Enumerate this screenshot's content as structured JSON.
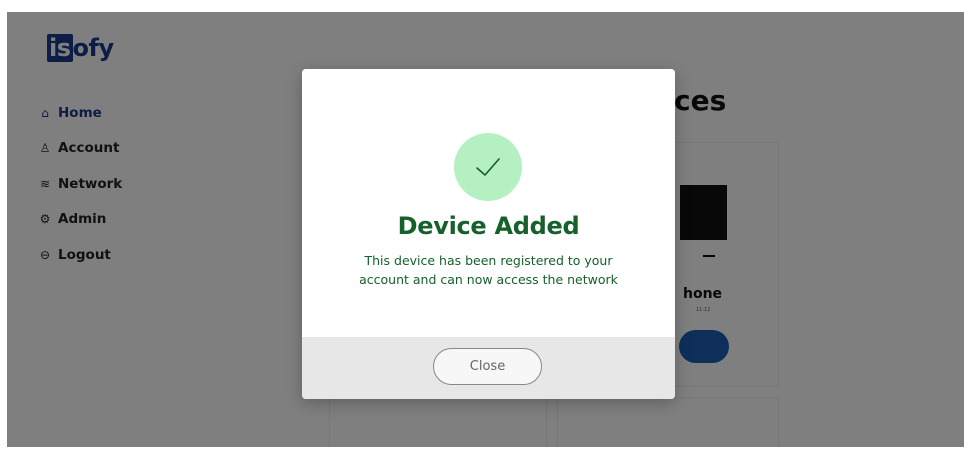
{
  "app": {
    "logo_is": "is",
    "logo_rest": "ofy"
  },
  "sidebar": {
    "items": [
      {
        "label": "Home",
        "icon": "home-icon",
        "glyph": "⌂",
        "active": true
      },
      {
        "label": "Account",
        "icon": "user-icon",
        "glyph": "♙",
        "active": false
      },
      {
        "label": "Network",
        "icon": "wifi-icon",
        "glyph": "≋",
        "active": false
      },
      {
        "label": "Admin",
        "icon": "gear-icon",
        "glyph": "⚙",
        "active": false
      },
      {
        "label": "Logout",
        "icon": "logout-icon",
        "glyph": "⊖",
        "active": false
      }
    ]
  },
  "main": {
    "title_visible_fragment": "ces",
    "device": {
      "name_visible_fragment": "hone",
      "meta_visible_fragment": "11:12"
    }
  },
  "modal": {
    "icon": "check-icon",
    "title": "Device Added",
    "message_line1": "This device has been registered to your",
    "message_line2": "account and can now access the network",
    "close_label": "Close"
  },
  "colors": {
    "brand": "#1c3a8a",
    "success_text": "#15602b",
    "success_circle": "#b4f0c2",
    "footer_bg": "#e7e7e7",
    "device_button": "#1a5fb4"
  }
}
